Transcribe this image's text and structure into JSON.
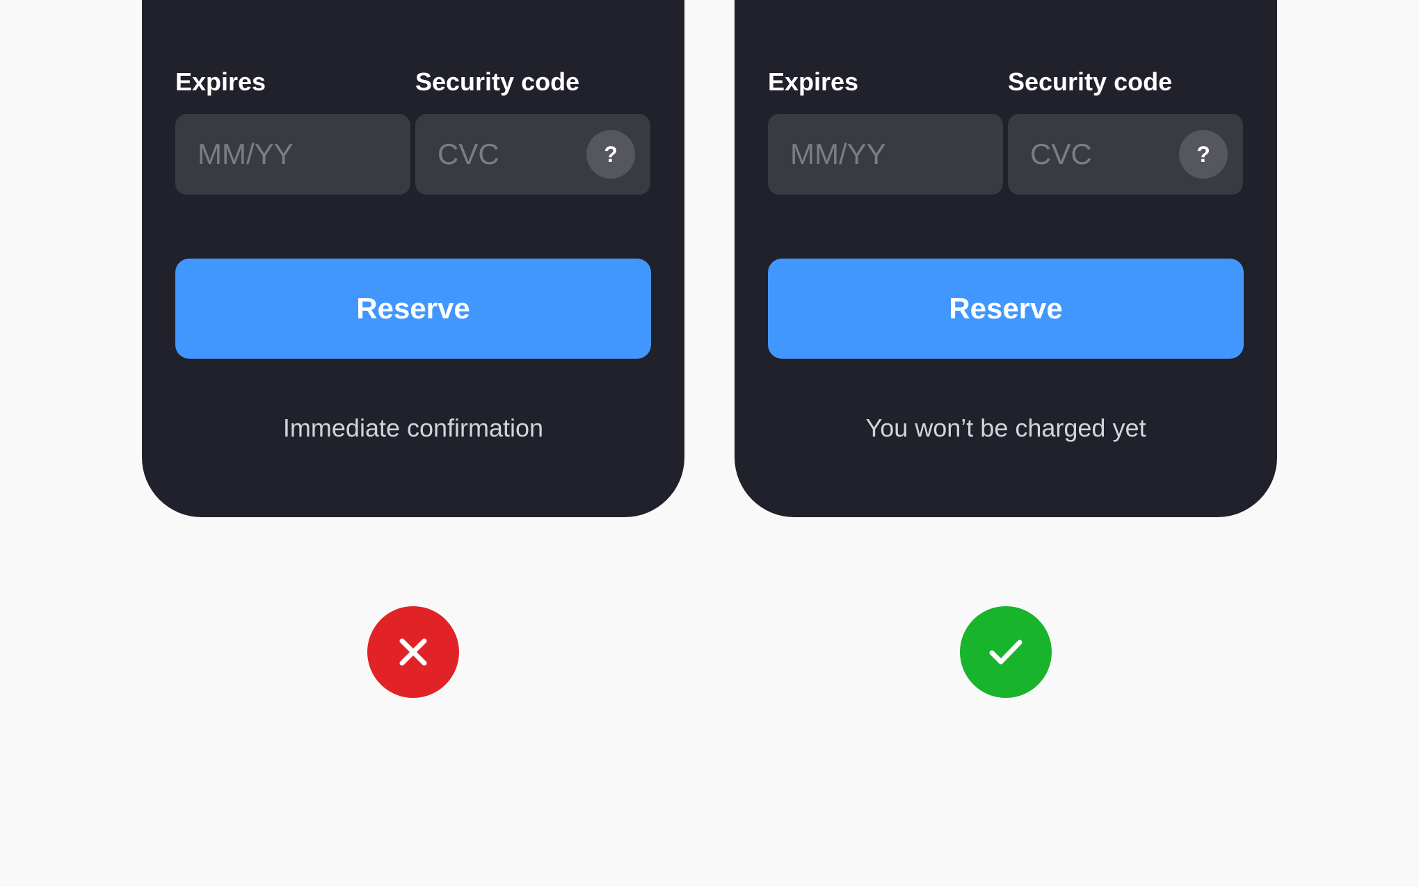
{
  "comparison": {
    "left": {
      "expires_label": "Expires",
      "security_label": "Security code",
      "expires_placeholder": "MM/YY",
      "cvc_placeholder": "CVC",
      "help_symbol": "?",
      "button_label": "Reserve",
      "note": "Immediate confirmation",
      "verdict_icon": "close-icon",
      "verdict_color": "#e12327"
    },
    "right": {
      "expires_label": "Expires",
      "security_label": "Security code",
      "expires_placeholder": "MM/YY",
      "cvc_placeholder": "CVC",
      "help_symbol": "?",
      "button_label": "Reserve",
      "note": "You won’t be charged yet",
      "verdict_icon": "checkmark-icon",
      "verdict_color": "#18b42c"
    }
  },
  "colors": {
    "page_background": "#f9f9f9",
    "panel_background": "#20212a",
    "input_background": "#393a42",
    "button_accent": "#4197fd"
  }
}
